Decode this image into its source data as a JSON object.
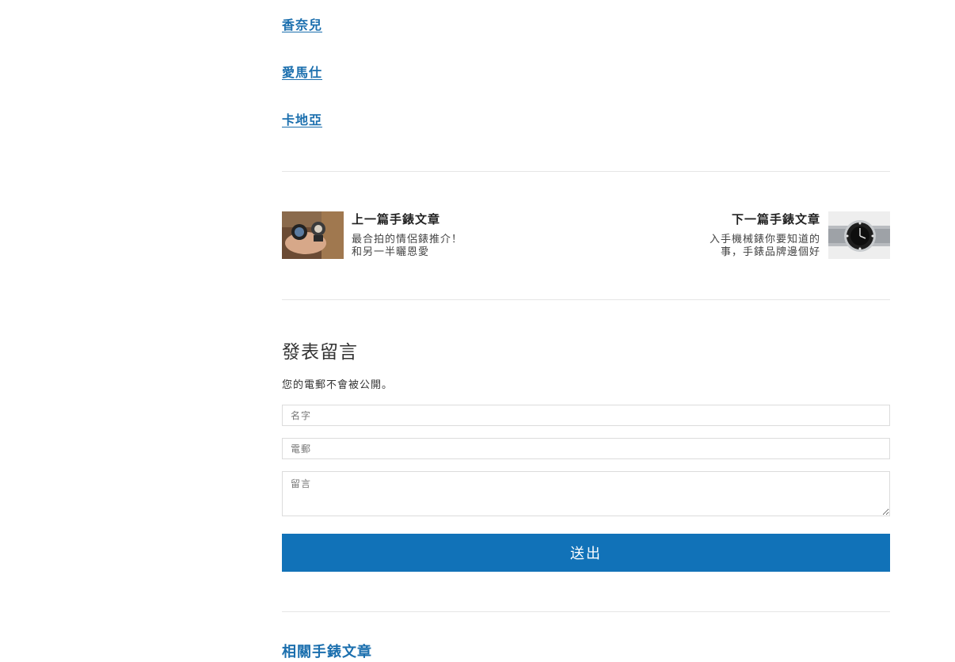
{
  "brand_links": [
    "香奈兒",
    "愛馬仕",
    "卡地亞"
  ],
  "post_nav": {
    "prev": {
      "title": "上一篇手錶文章",
      "excerpt": "最合拍的情侶錶推介！和另一半曬恩愛"
    },
    "next": {
      "title": "下一篇手錶文章",
      "excerpt": "入手機械錶你要知道的事，手錶品牌邊個好"
    }
  },
  "comment_form": {
    "title": "發表留言",
    "note": "您的電郵不會被公開。",
    "name_placeholder": "名字",
    "email_placeholder": "電郵",
    "comment_placeholder": "留言",
    "submit_label": "送出"
  },
  "next_section_heading": "相關手錶文章",
  "colors": {
    "link": "#1b6fae",
    "button": "#1172b8",
    "divider": "#e6e6e6"
  }
}
